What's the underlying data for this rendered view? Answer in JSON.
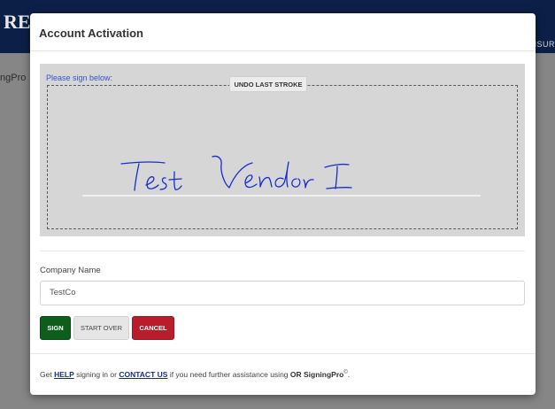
{
  "background": {
    "brand_fragment": "RE",
    "right_fragment": "NSUR",
    "left_fragment": "ngPro"
  },
  "modal": {
    "title": "Account Activation",
    "signature": {
      "prompt": "Please sign below:",
      "undo_label": "UNDO LAST STROKE",
      "ink_color": "#1a2bcc"
    },
    "company": {
      "label": "Company Name",
      "value": "TestCo"
    },
    "buttons": {
      "sign": "SIGN",
      "start_over": "START OVER",
      "cancel": "CANCEL"
    },
    "footer": {
      "prefix": "Get",
      "help_link": "HELP",
      "middle": "signing in or",
      "contact_link": "CONTACT US",
      "suffix": "if you need further assistance using",
      "product": "OR SigningPro",
      "mark": "©",
      "end": "."
    }
  },
  "colors": {
    "header_bg": "#0c1f47",
    "sign_green": "#0e5e1b",
    "cancel_red": "#b81d2c",
    "link_blue": "#1a2f8a"
  }
}
